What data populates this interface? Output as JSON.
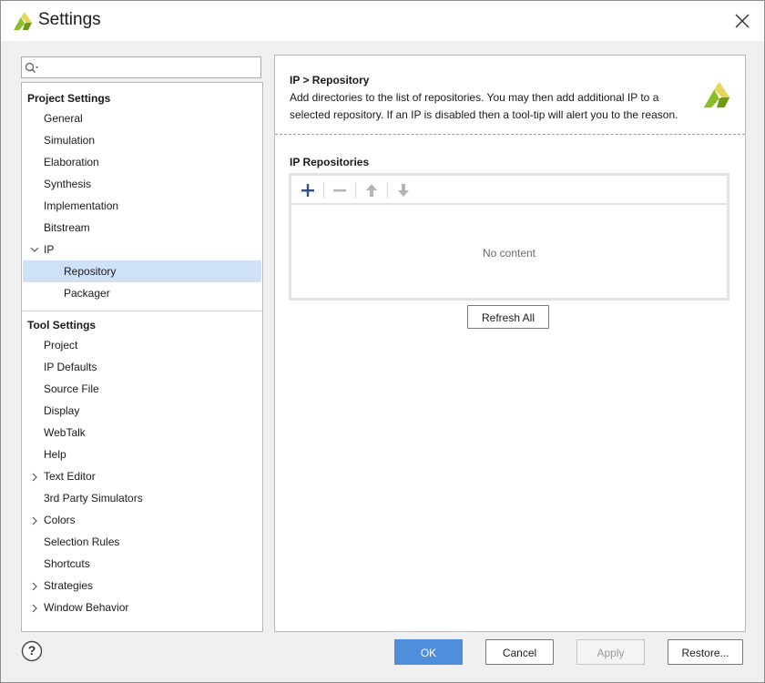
{
  "window": {
    "title": "Settings"
  },
  "search": {
    "value": "",
    "placeholder": ""
  },
  "tree": {
    "project_settings_title": "Project Settings",
    "project_items": [
      "General",
      "Simulation",
      "Elaboration",
      "Synthesis",
      "Implementation",
      "Bitstream"
    ],
    "ip_item": "IP",
    "ip_children": [
      "Repository",
      "Packager"
    ],
    "selected": "Repository",
    "tool_settings_title": "Tool Settings",
    "tool_items": [
      "Project",
      "IP Defaults",
      "Source File",
      "Display",
      "WebTalk",
      "Help",
      "Text Editor",
      "3rd Party Simulators",
      "Colors",
      "Selection Rules",
      "Shortcuts",
      "Strategies",
      "Window Behavior"
    ],
    "expandable_tool_items": [
      "Text Editor",
      "Colors",
      "Strategies",
      "Window Behavior"
    ]
  },
  "panel": {
    "breadcrumb": "IP > Repository",
    "description_line1": "Add directories to the list of repositories. You may then add additional IP to a",
    "description_line2": "selected repository. If an IP is disabled then a tool-tip will alert you to the reason.",
    "repositories_title": "IP Repositories",
    "toolbar_icons": [
      "add-icon",
      "remove-icon",
      "move-up-icon",
      "move-down-icon"
    ],
    "empty_text": "No content",
    "refresh_label": "Refresh All"
  },
  "footer": {
    "help_glyph": "?",
    "ok_label": "OK",
    "cancel_label": "Cancel",
    "apply_label": "Apply",
    "restore_label": "Restore..."
  },
  "colors": {
    "accent": "#4f8edb",
    "selection": "#cfe0f9",
    "logo_green": "#8dbd26",
    "logo_yellow": "#e7d65a",
    "toolbar_add": "#2f4f86"
  }
}
